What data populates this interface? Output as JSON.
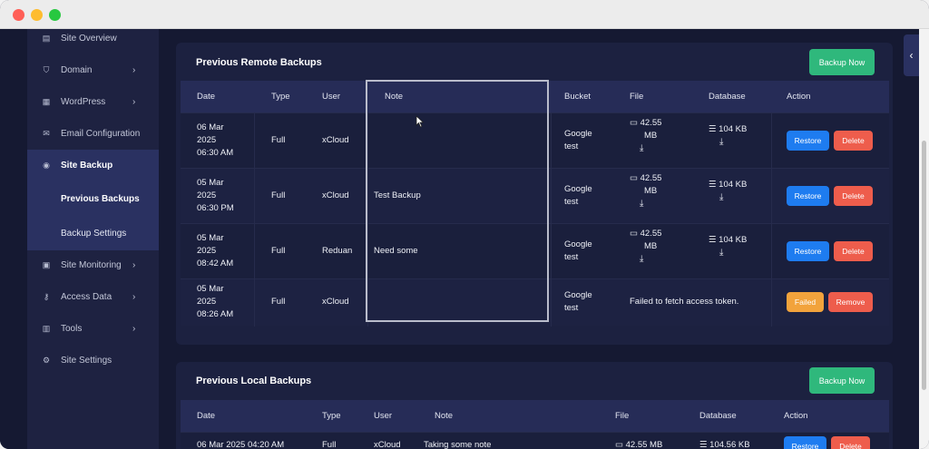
{
  "sidebar": {
    "items": [
      {
        "label": "Site Overview",
        "icon": "overview-icon",
        "glyph": "▤",
        "chevron": false
      },
      {
        "label": "Domain",
        "icon": "shield-icon",
        "glyph": "⛉",
        "chevron": true
      },
      {
        "label": "WordPress",
        "icon": "wordpress-icon",
        "glyph": "▦",
        "chevron": true
      },
      {
        "label": "Email Configuration",
        "icon": "mail-icon",
        "glyph": "✉",
        "chevron": false
      },
      {
        "label": "Site Backup",
        "icon": "backup-icon",
        "glyph": "◉",
        "chevron": false
      },
      {
        "label": "Site Monitoring",
        "icon": "monitor-icon",
        "glyph": "▣",
        "chevron": true
      },
      {
        "label": "Access Data",
        "icon": "key-icon",
        "glyph": "⚷",
        "chevron": true
      },
      {
        "label": "Tools",
        "icon": "tools-icon",
        "glyph": "▥",
        "chevron": true
      },
      {
        "label": "Site Settings",
        "icon": "gear-icon",
        "glyph": "⚙",
        "chevron": false
      }
    ],
    "sub_items": [
      {
        "label": "Previous Backups"
      },
      {
        "label": "Backup Settings"
      }
    ]
  },
  "remote": {
    "title": "Previous Remote Backups",
    "backup_now": "Backup Now",
    "headers": {
      "date": "Date",
      "type": "Type",
      "user": "User",
      "note": "Note",
      "bucket": "Bucket",
      "file": "File",
      "database": "Database",
      "action": "Action"
    },
    "rows": [
      {
        "date": [
          "06 Mar",
          "2025",
          "06:30 AM"
        ],
        "type": "Full",
        "user": "xCloud",
        "note": "",
        "bucket": [
          "Google",
          "test"
        ],
        "file_size": [
          "42.55",
          "MB"
        ],
        "db_size": "104 KB",
        "actions": [
          "Restore",
          "Delete"
        ]
      },
      {
        "date": [
          "05 Mar",
          "2025",
          "06:30 PM"
        ],
        "type": "Full",
        "user": "xCloud",
        "note": "Test Backup",
        "bucket": [
          "Google",
          "test"
        ],
        "file_size": [
          "42.55",
          "MB"
        ],
        "db_size": "104 KB",
        "actions": [
          "Restore",
          "Delete"
        ]
      },
      {
        "date": [
          "05 Mar",
          "2025",
          "08:42 AM"
        ],
        "type": "Full",
        "user": "Reduan",
        "note": "Need some",
        "bucket": [
          "Google",
          "test"
        ],
        "file_size": [
          "42.55",
          "MB"
        ],
        "db_size": "104 KB",
        "actions": [
          "Restore",
          "Delete"
        ]
      },
      {
        "date": [
          "05 Mar",
          "2025",
          "08:26 AM"
        ],
        "type": "Full",
        "user": "xCloud",
        "note": "",
        "bucket": [
          "Google",
          "test"
        ],
        "error": "Failed to fetch access token.",
        "actions": [
          "Failed",
          "Remove"
        ]
      }
    ]
  },
  "local": {
    "title": "Previous Local Backups",
    "backup_now": "Backup Now",
    "headers": {
      "date": "Date",
      "type": "Type",
      "user": "User",
      "note": "Note",
      "file": "File",
      "database": "Database",
      "action": "Action"
    },
    "rows": [
      {
        "date": "06 Mar 2025 04:20 AM",
        "type": "Full",
        "user": "xCloud",
        "note": "Taking some note",
        "file_size": "42.55 MB",
        "db_size": "104.56 KB",
        "actions": [
          "Restore",
          "Delete"
        ]
      }
    ]
  },
  "colors": {
    "green": "#2fb87c",
    "blue": "#1e7cf0",
    "red": "#ee5d4c",
    "orange": "#f2a33c",
    "sidebar_active": "#2a3161"
  }
}
